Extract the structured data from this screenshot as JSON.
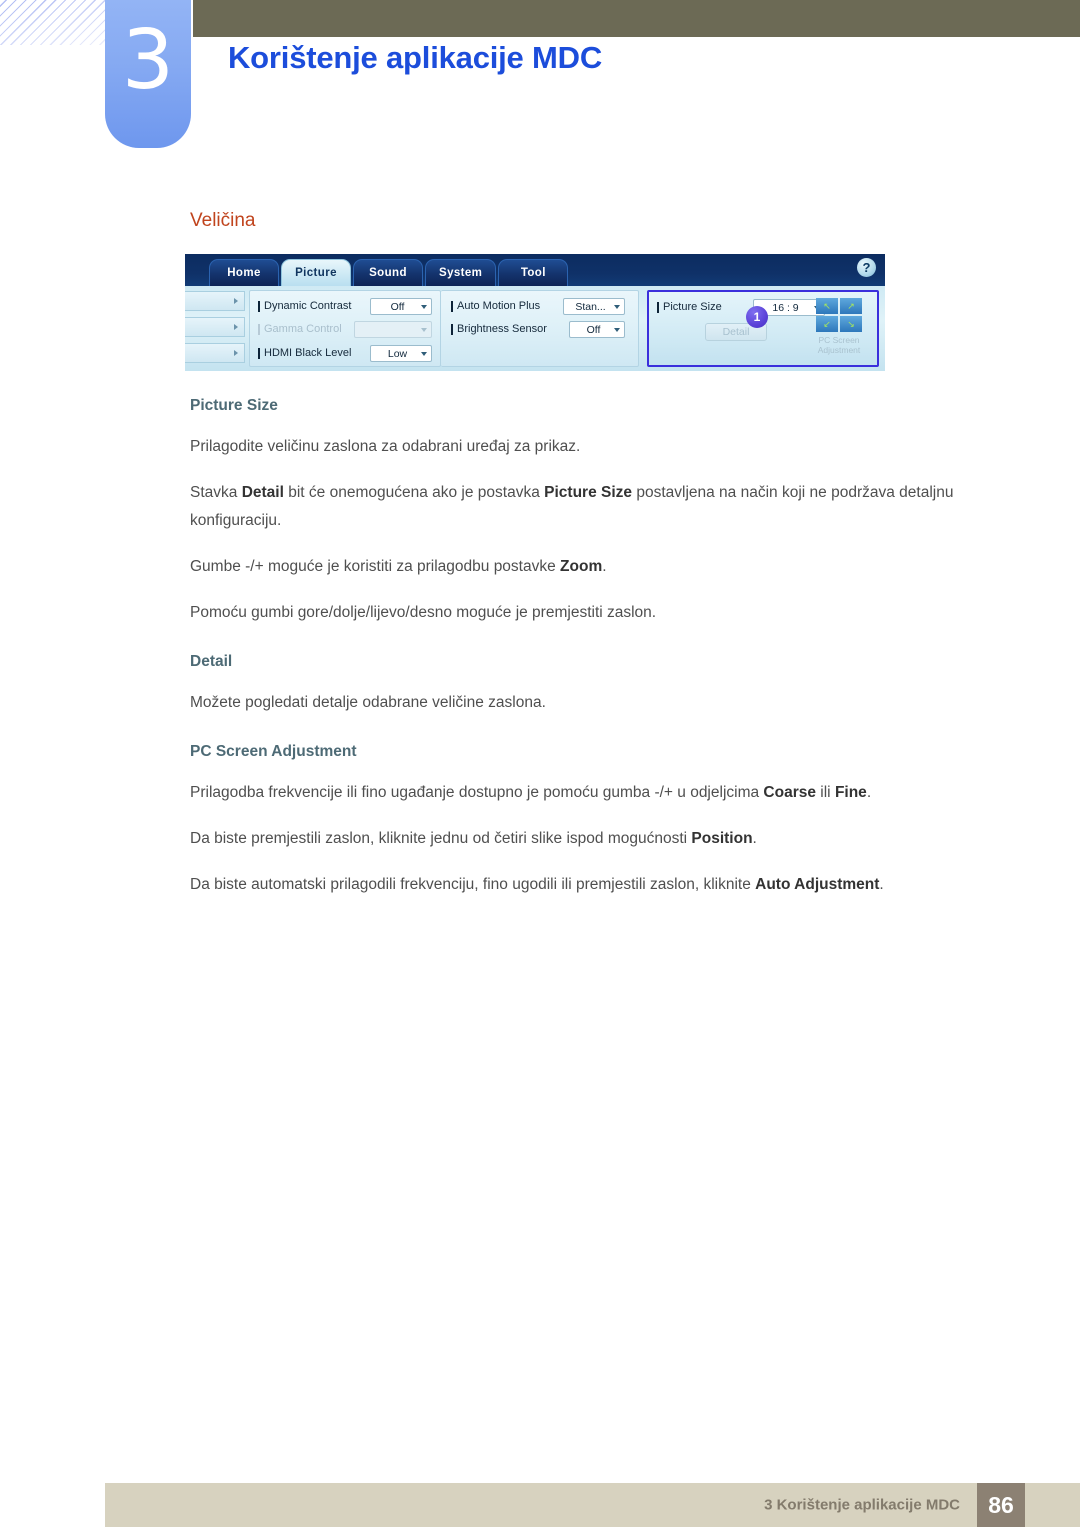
{
  "header": {
    "chapter_number": "3",
    "chapter_title": "Korištenje aplikacije MDC"
  },
  "content": {
    "section_title": "Veličina"
  },
  "mdc_app": {
    "tabs": [
      {
        "label": "Home",
        "active": false
      },
      {
        "label": "Picture",
        "active": true
      },
      {
        "label": "Sound",
        "active": false
      },
      {
        "label": "System",
        "active": false
      },
      {
        "label": "Tool",
        "active": false
      }
    ],
    "help_icon": "?",
    "badge": "1",
    "fields": [
      {
        "label": "Dynamic Contrast",
        "value": "Off",
        "disabled": false
      },
      {
        "label": "Gamma Control",
        "value": "",
        "disabled": true
      },
      {
        "label": "HDMI Black Level",
        "value": "Low",
        "disabled": false
      },
      {
        "label": "Auto Motion Plus",
        "value": "Stan...",
        "disabled": false
      },
      {
        "label": "Brightness Sensor",
        "value": "Off",
        "disabled": false
      },
      {
        "label": "Picture Size",
        "value": "16 : 9",
        "disabled": false
      }
    ],
    "detail_button": "Detail",
    "pc_screen_adjustment_label": "PC Screen\nAdjustment",
    "pc_screen_adjustment_line1": "PC Screen",
    "pc_screen_adjustment_line2": "Adjustment",
    "arrow_glyphs": [
      "↖",
      "↗",
      "↙",
      "↘"
    ]
  },
  "doc": {
    "h_picture_size": "Picture Size",
    "p_picture_size_1": "Prilagodite veličinu zaslona za odabrani uređaj za prikaz.",
    "p_detail_disabled_a": "Stavka ",
    "p_detail_disabled_b": "Detail",
    "p_detail_disabled_c": " bit će onemogućena ako je postavka ",
    "p_detail_disabled_d": "Picture Size",
    "p_detail_disabled_e": " postavljena na način koji ne podržava detaljnu konfiguraciju.",
    "p_zoom_a": "Gumbe -/+ moguće je koristiti za prilagodbu postavke ",
    "p_zoom_b": "Zoom",
    "p_zoom_c": ".",
    "p_move": "Pomoću gumbi gore/dolje/lijevo/desno moguće je premjestiti zaslon.",
    "h_detail": "Detail",
    "p_detail_1": "Možete pogledati detalje odabrane veličine zaslona.",
    "h_pc_screen": "PC Screen Adjustment",
    "p_pc_1_a": "Prilagodba frekvencije ili fino ugađanje dostupno je pomoću gumba -/+ u odjeljcima ",
    "p_pc_1_b": "Coarse",
    "p_pc_1_c": " ili ",
    "p_pc_1_d": "Fine",
    "p_pc_1_e": ".",
    "p_pc_2_a": "Da biste premjestili zaslon, kliknite jednu od četiri slike ispod mogućnosti ",
    "p_pc_2_b": "Position",
    "p_pc_2_c": ".",
    "p_pc_3_a": "Da biste automatski prilagodili frekvenciju, fino ugodili ili premjestili zaslon, kliknite ",
    "p_pc_3_b": "Auto Adjustment",
    "p_pc_3_c": "."
  },
  "footer": {
    "text": "3 Korištenje aplikacije MDC",
    "page_number": "86"
  },
  "colors": {
    "chapter_title": "#1c4ddb",
    "section_title": "#c0441d",
    "olive_bar": "#6c6a55",
    "badge_blue": "#5b42d8",
    "footer_bar": "#d7d2bf",
    "footer_page_box": "#8c8173",
    "highlight_border": "#3a2fdc"
  }
}
